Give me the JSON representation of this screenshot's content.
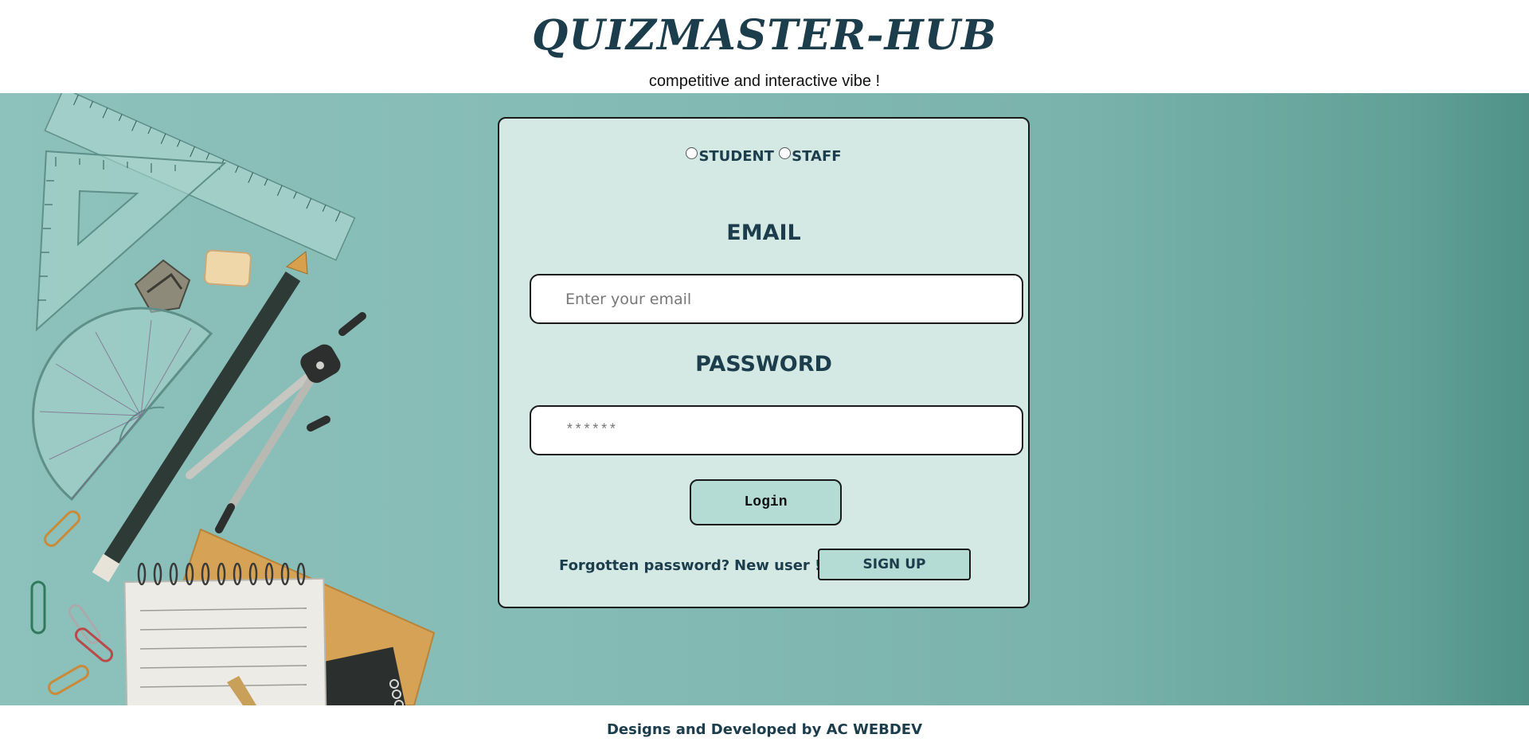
{
  "header": {
    "title": "QUIZMASTER-HUB",
    "tagline": "competitive and interactive vibe !"
  },
  "login_form": {
    "roles": [
      {
        "label": "STUDENT",
        "selected": false
      },
      {
        "label": "STAFF",
        "selected": false
      }
    ],
    "email": {
      "label": "EMAIL",
      "placeholder": "Enter your email",
      "value": ""
    },
    "password": {
      "label": "PASSWORD",
      "placeholder": "******",
      "value": ""
    },
    "login_label": "Login",
    "forgot_label": "Forgotten password?",
    "new_user_label": "New user !",
    "signup_label": "SIGN UP"
  },
  "footer": {
    "text": "Designs and Developed by AC WEBDEV"
  },
  "colors": {
    "primary_text": "#1c3d4c",
    "card_bg": "#d4e8e4",
    "button_bg": "#b5dcd4",
    "background_teal": "#86bcb6"
  },
  "hero_image": {
    "items": [
      "ruler",
      "set-square",
      "sharpener",
      "eraser",
      "pencil",
      "protractor",
      "compass",
      "paper-clips",
      "spiral-notepad",
      "notebook"
    ]
  }
}
